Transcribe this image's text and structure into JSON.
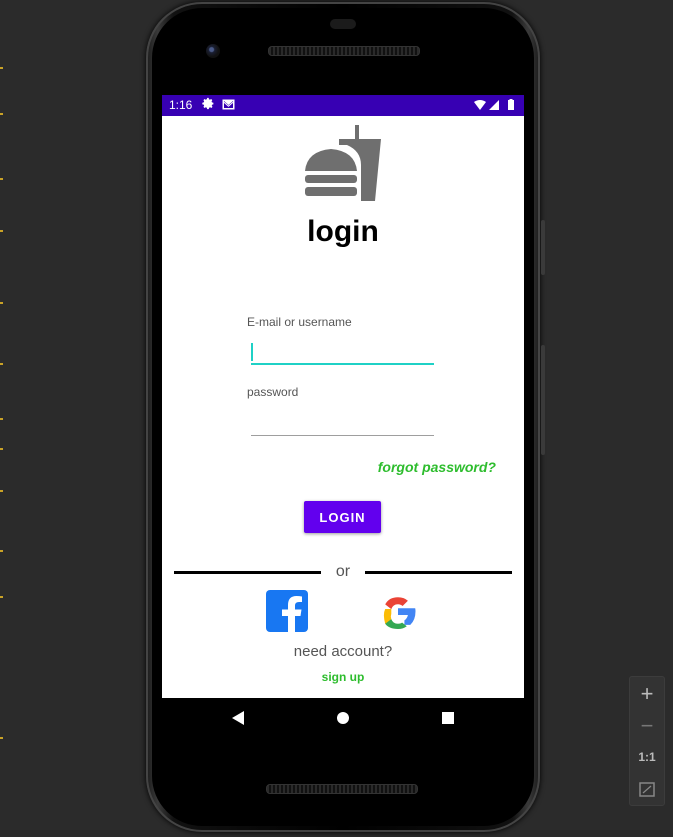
{
  "status_bar": {
    "time": "1:16",
    "icons": [
      "gear-icon",
      "mail-icon",
      "wifi-icon",
      "signal-icon",
      "battery-icon"
    ]
  },
  "login_screen": {
    "title": "login",
    "email_label": "E-mail or username",
    "email_value": "",
    "password_label": "password",
    "password_value": "",
    "forgot_password": "forgot password?",
    "login_button": "LOGIN",
    "divider_text": "or",
    "social_buttons": [
      "facebook-icon",
      "google-icon"
    ],
    "need_account": "need account?",
    "sign_up": "sign up"
  },
  "nav_bar": {
    "buttons": [
      "back-icon",
      "home-icon",
      "recents-icon"
    ]
  },
  "zoom_controls": {
    "zoom_in": "+",
    "zoom_out": "−",
    "actual_size": "1:1",
    "fit_icon": "fit-screen-icon"
  },
  "colors": {
    "status_bar": "#3700b3",
    "accent": "#6200ee",
    "link_green": "#2ebd2e",
    "input_focus": "#1fd1c6",
    "logo_gray": "#6f6f6f"
  }
}
